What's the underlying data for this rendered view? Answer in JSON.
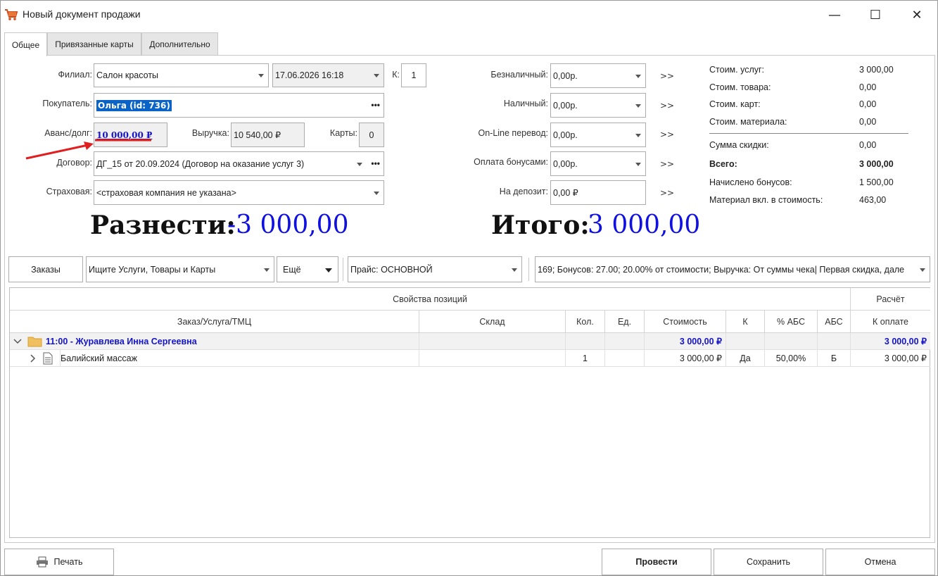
{
  "window": {
    "title": "Новый документ продажи",
    "minimize": "—",
    "maximize": "☐",
    "close": "✕"
  },
  "tabs": [
    {
      "label": "Общее"
    },
    {
      "label": "Привязанные карты"
    },
    {
      "label": "Дополнительно"
    }
  ],
  "form": {
    "branch_label": "Филиал:",
    "branch_value": "Салон красоты",
    "date_value": "17.06.2026 16:18",
    "k_label": "К:",
    "k_value": "1",
    "buyer_label": "Покупатель:",
    "buyer_value": "Ольга  (id: 736)",
    "advance_label": "Аванс/долг:",
    "advance_value": "10 000,00 ₽",
    "revenue_label": "Выручка:",
    "revenue_value": "10 540,00 ₽",
    "cards_label": "Карты:",
    "cards_value": "0",
    "contract_label": "Договор:",
    "contract_value": "ДГ_15 от 20.09.2024 (Договор на оказание услуг 3)",
    "insurance_label": "Страховая:",
    "insurance_value": "<страховая компания не указана>"
  },
  "payments": [
    {
      "label": "Безналичный:",
      "value": "0,00р.",
      "go": ">>"
    },
    {
      "label": "Наличный:",
      "value": "0,00р.",
      "go": ">>"
    },
    {
      "label": "On-Line перевод:",
      "value": "0,00р.",
      "go": ">>"
    },
    {
      "label": "Оплата бонусами:",
      "value": "0,00р.",
      "go": ">>"
    },
    {
      "label": "На депозит:",
      "value": "0,00 ₽",
      "go": ">>"
    }
  ],
  "summary": [
    {
      "label": "Стоим. услуг:",
      "value": "3 000,00"
    },
    {
      "label": "Стоим. товара:",
      "value": "0,00"
    },
    {
      "label": "Стоим. карт:",
      "value": "0,00"
    },
    {
      "label": "Стоим. материала:",
      "value": "0,00"
    },
    {
      "label": "Сумма скидки:",
      "value": "0,00"
    },
    {
      "label": "Всего:",
      "value": "3 000,00"
    },
    {
      "label": "Начислено бонусов:",
      "value": "1 500,00"
    },
    {
      "label": "Материал вкл. в стоимость:",
      "value": "463,00"
    }
  ],
  "totals": {
    "distribute_label": "Разнести:",
    "distribute_value": "-3 000,00",
    "total_label": "Итого:",
    "total_value": "3 000,00"
  },
  "toolbar": {
    "orders_button": "Заказы",
    "search_placeholder": "Ищите Услуги, Товары и Карты",
    "more_label": "Ещё",
    "price_label": "Прайс: ОСНОВНОЙ",
    "discount_info": "169; Бонусов: 27.00; 20.00% от стоимости; Выручка: От суммы чека| Первая скидка, дале"
  },
  "grid": {
    "group_headers": [
      "Свойства позиций",
      "Расчёт"
    ],
    "columns": [
      "Заказ/Услуга/ТМЦ",
      "Склад",
      "Кол.",
      "Ед.",
      "Стоимость",
      "К",
      "% АБС",
      "АБС",
      "К оплате"
    ],
    "group_row": {
      "title": "11:00 - Журавлева Инна Сергеевна",
      "cost": "3 000,00 ₽",
      "to_pay": "3 000,00 ₽"
    },
    "rows": [
      {
        "name": "Балийский массаж",
        "warehouse": "",
        "qty": "1",
        "unit": "",
        "cost": "3 000,00 ₽",
        "k": "Да",
        "abs_pct": "50,00%",
        "abs": "Б",
        "to_pay": "3 000,00 ₽"
      }
    ]
  },
  "footer": {
    "print": "Печать",
    "post": "Провести",
    "save": "Сохранить",
    "cancel": "Отмена"
  },
  "colors": {
    "accent_blue": "#1010e0",
    "link_blue": "#1414c8",
    "annotation_red": "#e02020",
    "selection": "#0a64c8"
  }
}
